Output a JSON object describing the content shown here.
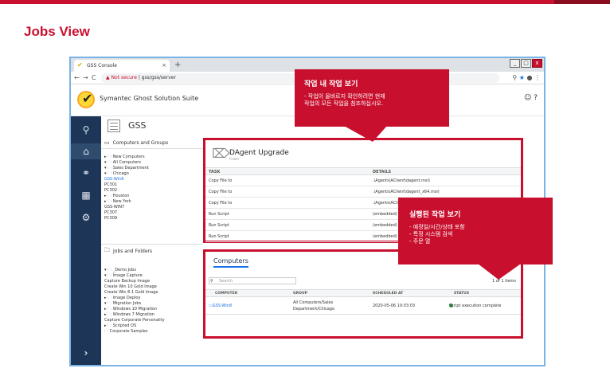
{
  "slide": {
    "title": "Jobs View"
  },
  "browser": {
    "tab_title": "GSS Console",
    "tab_close": "×",
    "new_tab": "+",
    "url_warning": "Not secure",
    "url_sep": " | ",
    "url": "gss/gss/server",
    "back": "←",
    "forward": "→",
    "reload": "C",
    "win_min": "_",
    "win_max": "□",
    "win_close": "x"
  },
  "app": {
    "name": "Symantec Ghost Solution Suite",
    "section_title": "GSS"
  },
  "tree": {
    "header": "Computers and Groups",
    "items": [
      "▸ 🗀 New Computers",
      "▾ 🗀 All Computers",
      "  ▾ 🗀 Sales Department",
      "    ▾ 🗀 Chicago",
      "        GSS-Win8",
      "        PC301",
      "        PC302",
      "    ▸ 🗀 Houston",
      "    ▸ 🗀 New York",
      "      GSS-WIN7",
      "      PC307",
      "      PC309"
    ]
  },
  "jobs": {
    "header": "Jobs and Folders",
    "items": [
      "▾ 🗀 _Demo Jobs",
      "  ▾ 🗀 Image Capture",
      "        Capture Backup Image",
      "        Create Win 10 Gold Image",
      "        Create Win 8.1 Gold Image",
      "  ▸ 🗀 Image Deploy",
      "  ▾ 🗀 Migration Jobs",
      "    ▸ 🗀 Windows 10 Migration",
      "    ▸ 🗀 Windows 7 Migration",
      "        Capture Corporate Personality",
      "  ▸ 🗀 Scripted OS",
      "  🗀 Corporate Samples"
    ]
  },
  "detail": {
    "title": "DAgent Upgrade",
    "subtitle": "Folder",
    "col_task": "TASK",
    "col_details": "DETAILS",
    "rows": [
      {
        "task": "Copy File to",
        "details": ".\\Agents\\AClient\\dagent.msi)"
      },
      {
        "task": "Copy File to",
        "details": ".\\Agents\\AClient\\dagent_x64.msi)"
      },
      {
        "task": "Copy File to",
        "details": ".\\Agents\\AClie"
      },
      {
        "task": "Run Script",
        "details": "(embedded)"
      },
      {
        "task": "Run Script",
        "details": "(embedded)"
      },
      {
        "task": "Run Script",
        "details": "(embedded)"
      }
    ]
  },
  "computers": {
    "title": "Computers",
    "search_placeholder": "Search",
    "pager": "1 of 1 items",
    "col_computer": "COMPUTER",
    "col_group": "GROUP",
    "col_scheduled": "SCHEDULED AT",
    "col_status": "STATUS",
    "row": {
      "computer": "GSS-Win8",
      "group_line1": "All Computers/Sales",
      "group_line2": "Department/Chicago",
      "scheduled": "2020-05-06 10:03:03",
      "status": "Script execution complete"
    }
  },
  "callout1": {
    "title": "작업 내 작업 보기",
    "line1": "- 작업이 올바르지 확인하려면 현재",
    "line2": "  작업의 모든 작업을 참조하십시오."
  },
  "callout2": {
    "title": "실행된 작업 보기",
    "line1": "- 예정일/시간/상태 포함",
    "line2": "- 특정 시스템 검색",
    "line3": "- 주문 열"
  },
  "colors": {
    "accent": "#c8102e",
    "nav": "#1d3557",
    "link": "#1a73e8"
  },
  "icons": [
    "search-icon",
    "home-icon",
    "network-icon",
    "report-icon",
    "settings-icon",
    "expand-icon",
    "help-icon",
    "user-icon",
    "star-icon"
  ]
}
